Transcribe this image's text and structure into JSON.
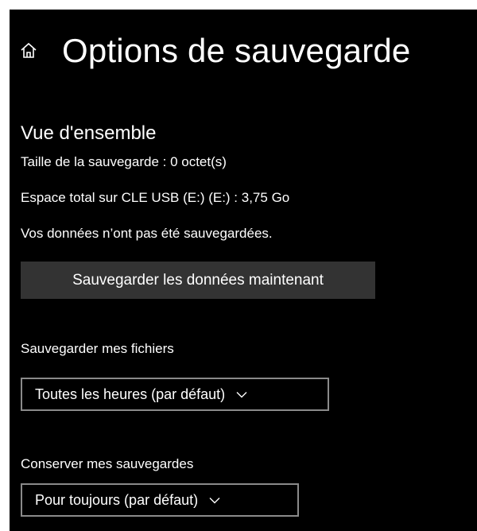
{
  "header": {
    "title": "Options de sauvegarde",
    "home_icon": "home-icon"
  },
  "overview": {
    "title": "Vue d'ensemble",
    "backup_size": "Taille de la sauvegarde : 0 octet(s)",
    "total_space": "Espace total sur CLE USB (E:) (E:) : 3,75 Go",
    "status": "Vos données n’ont pas été sauvegardées.",
    "backup_now_label": "Sauvegarder les données maintenant"
  },
  "backup_files": {
    "label": "Sauvegarder mes fichiers",
    "selected": "Toutes les heures (par défaut)"
  },
  "keep_backups": {
    "label": "Conserver mes sauvegardes",
    "selected": "Pour toujours (par défaut)"
  },
  "colors": {
    "background": "#000000",
    "text": "#ffffff",
    "button_bg": "#333333",
    "select_border": "#8a8a8a"
  }
}
